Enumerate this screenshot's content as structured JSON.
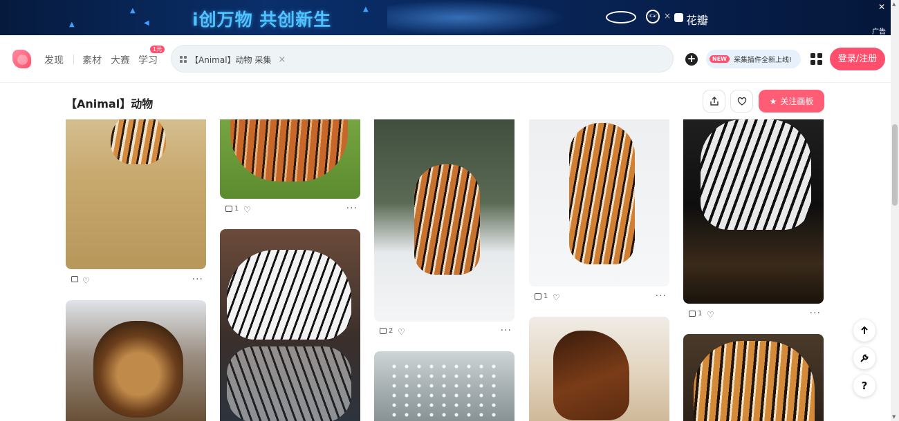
{
  "ad": {
    "slogan": "i创万物 共创新生",
    "brand_partner": "花瓣",
    "brand_b_text": "iCar",
    "times": "×",
    "close": "✕",
    "label": "广告"
  },
  "header": {
    "nav": {
      "discover": "发现",
      "material": "素材",
      "contest": "大赛",
      "learn": "学习",
      "learn_badge": "1元"
    },
    "search_chip": "【Animal】动物 采集",
    "chip_close": "×",
    "promo_new": "NEW",
    "promo_text": "采集插件全新上线!",
    "login": "登录/注册"
  },
  "board": {
    "title": "【Animal】动物",
    "follow": "关注画板"
  },
  "pins": [
    {
      "subject": "tiger-in-grass",
      "repins": ""
    },
    {
      "subject": "tiger-on-grass",
      "repins": "1"
    },
    {
      "subject": "tiger-in-snow-forest",
      "repins": "2"
    },
    {
      "subject": "tiger-running-snow",
      "repins": "1"
    },
    {
      "subject": "white-tiger-drinking",
      "repins": "1"
    },
    {
      "subject": "lion"
    },
    {
      "subject": "white-tiger-water"
    },
    {
      "subject": "sparkling-water"
    },
    {
      "subject": "horse-running"
    },
    {
      "subject": "tiger-face"
    }
  ],
  "more": "···",
  "colors": {
    "accent": "#ff4f6c",
    "ad_bg": "#0a2f6b",
    "search_bg": "#eef3f6"
  }
}
